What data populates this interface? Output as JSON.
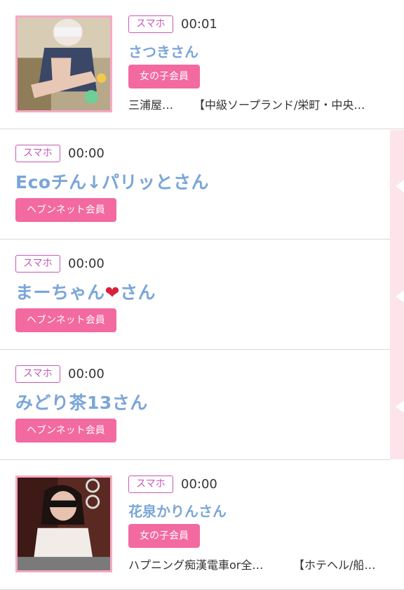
{
  "items": [
    {
      "device": "スマホ",
      "time": "00:01",
      "name": "さつきさん",
      "member": "女の子会員",
      "shop_area": "三浦屋…",
      "shop_name": "【中級ソープランド/栄町・中央…"
    },
    {
      "device": "スマホ",
      "time": "00:00",
      "name": "Ecoチん↓パリッとさん",
      "member": "ヘブンネット会員"
    },
    {
      "device": "スマホ",
      "time": "00:00",
      "name_pre": "まーちゃん",
      "name_heart": "❤",
      "name_post": "さん",
      "member": "ヘブンネット会員"
    },
    {
      "device": "スマホ",
      "time": "00:00",
      "name": "みどり茶13さん",
      "member": "ヘブンネット会員"
    },
    {
      "device": "スマホ",
      "time": "00:00",
      "name": "花泉かりんさん",
      "member": "女の子会員",
      "shop_area": "ハプニング痴漢電車or全…",
      "shop_name": "【ホテヘル/船…"
    }
  ],
  "colors": {
    "device_badge": "#c45ab8",
    "name": "#7aa6d8",
    "member_badge": "#f26aa0",
    "side_strip": "#fde3ea",
    "thumb_border": "#f7a9c4"
  }
}
